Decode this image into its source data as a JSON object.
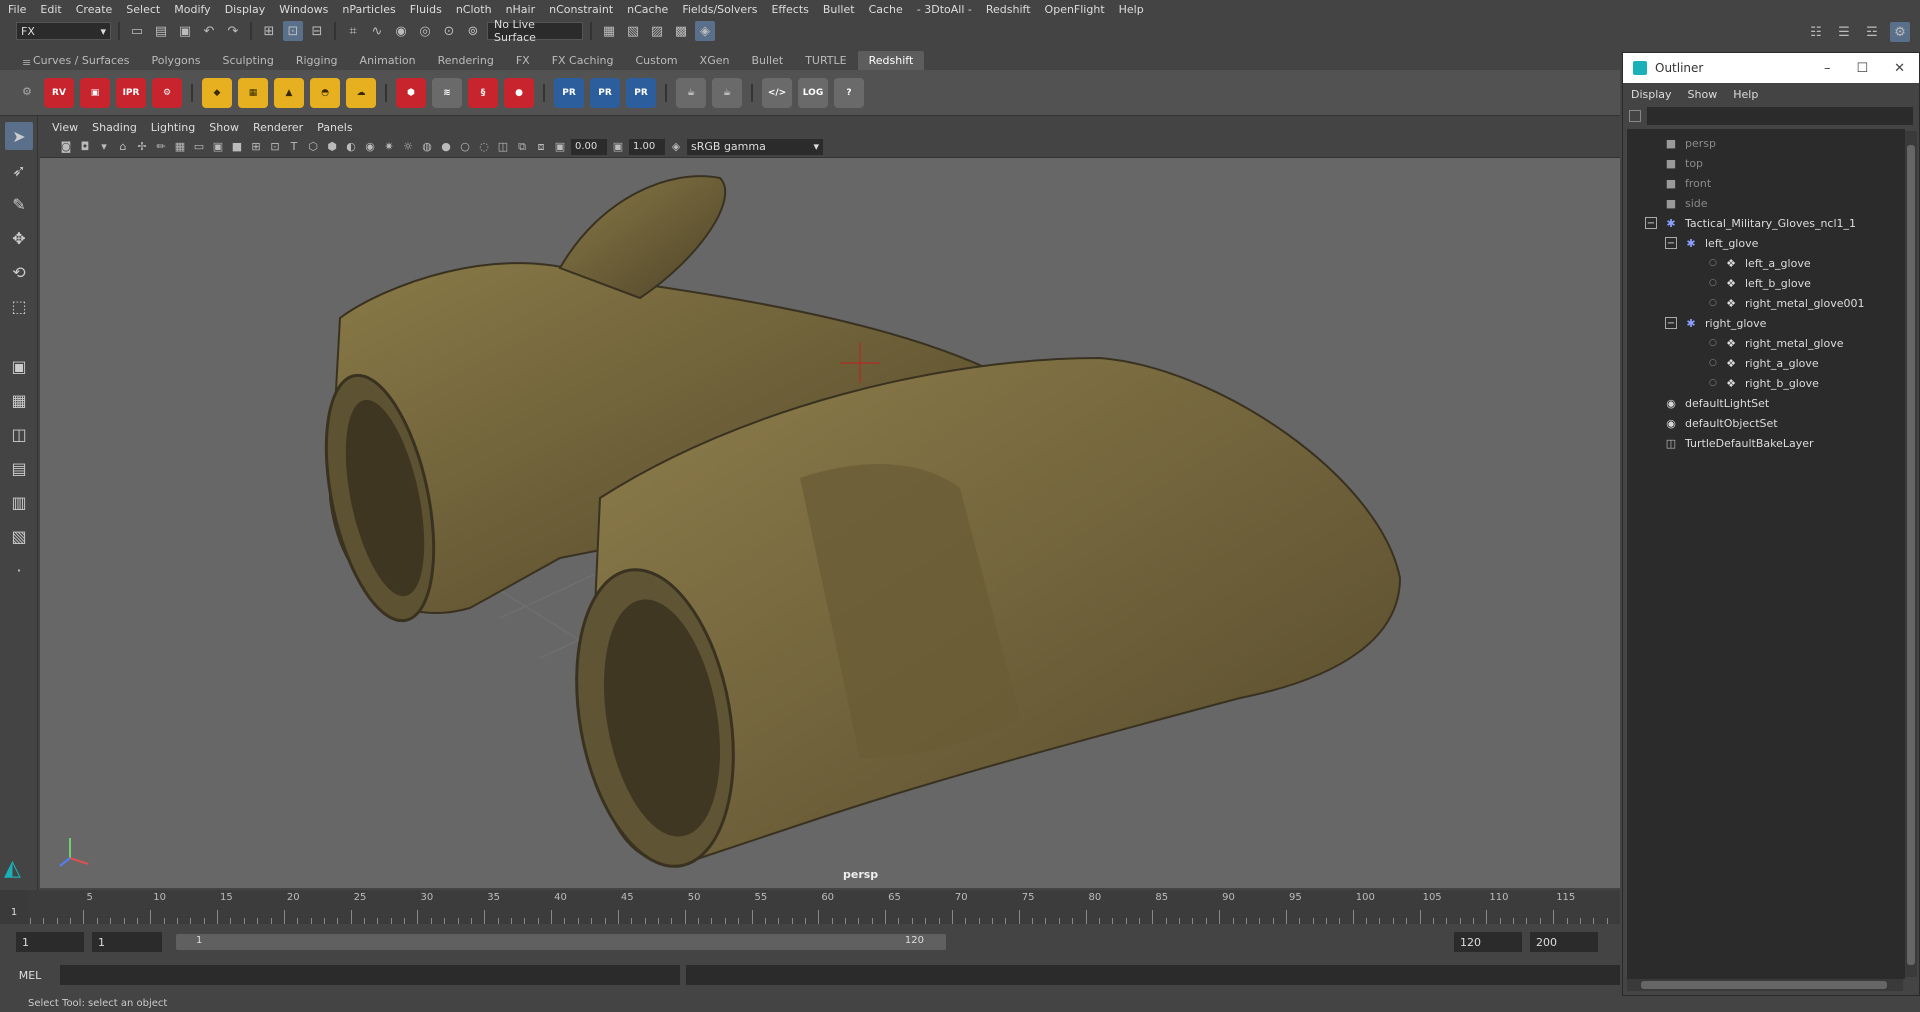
{
  "menubar": [
    "File",
    "Edit",
    "Create",
    "Select",
    "Modify",
    "Display",
    "Windows",
    "nParticles",
    "Fluids",
    "nCloth",
    "nHair",
    "nConstraint",
    "nCache",
    "Fields/Solvers",
    "Effects",
    "Bullet",
    "Cache",
    "- 3DtoAll -",
    "Redshift",
    "OpenFlight",
    "Help"
  ],
  "status": {
    "mode": "FX",
    "live_surface": "No Live Surface"
  },
  "shelf_tabs": [
    "Curves / Surfaces",
    "Polygons",
    "Sculpting",
    "Rigging",
    "Animation",
    "Rendering",
    "FX",
    "FX Caching",
    "Custom",
    "XGen",
    "Bullet",
    "TURTLE",
    "Redshift"
  ],
  "shelf_icons": {
    "rv": "RV",
    "ipr": "IPR",
    "pr": "PR",
    "log": "LOG"
  },
  "viewport": {
    "menu": [
      "View",
      "Shading",
      "Lighting",
      "Show",
      "Renderer",
      "Panels"
    ],
    "exposure": "0.00",
    "gamma": "1.00",
    "colorspace": "sRGB gamma",
    "camera_label": "persp"
  },
  "timeline": {
    "ticks": [
      "5",
      "10",
      "15",
      "20",
      "25",
      "30",
      "35",
      "40",
      "45",
      "50",
      "55",
      "60",
      "65",
      "70",
      "75",
      "80",
      "85",
      "90",
      "95",
      "100",
      "105",
      "110",
      "115"
    ],
    "current": "1"
  },
  "range": {
    "start": "1",
    "playback_start": "1",
    "slider_start": "1",
    "slider_end": "120",
    "playback_end": "120",
    "end": "200"
  },
  "cmd": {
    "label": "MEL"
  },
  "help_line": "Select Tool: select an object",
  "outliner": {
    "title": "Outliner",
    "menu": [
      "Display",
      "Show",
      "Help"
    ],
    "items": [
      {
        "label": "persp",
        "level": 0,
        "dim": true,
        "icon": "camera-icon"
      },
      {
        "label": "top",
        "level": 0,
        "dim": true,
        "icon": "camera-icon"
      },
      {
        "label": "front",
        "level": 0,
        "dim": true,
        "icon": "camera-icon"
      },
      {
        "label": "side",
        "level": 0,
        "dim": true,
        "icon": "camera-icon"
      },
      {
        "label": "Tactical_Military_Gloves_ncl1_1",
        "level": 0,
        "expand": "−",
        "icon": "group-icon"
      },
      {
        "label": "left_glove",
        "level": 1,
        "expand": "−",
        "icon": "group-icon"
      },
      {
        "label": "left_a_glove",
        "level": 2,
        "icon": "mesh-icon"
      },
      {
        "label": "left_b_glove",
        "level": 2,
        "icon": "mesh-icon"
      },
      {
        "label": "right_metal_glove001",
        "level": 2,
        "icon": "mesh-icon"
      },
      {
        "label": "right_glove",
        "level": 1,
        "expand": "−",
        "icon": "group-icon"
      },
      {
        "label": "right_metal_glove",
        "level": 2,
        "icon": "mesh-icon"
      },
      {
        "label": "right_a_glove",
        "level": 2,
        "icon": "mesh-icon"
      },
      {
        "label": "right_b_glove",
        "level": 2,
        "icon": "mesh-icon"
      },
      {
        "label": "defaultLightSet",
        "level": 0,
        "icon": "set-icon"
      },
      {
        "label": "defaultObjectSet",
        "level": 0,
        "icon": "set-icon"
      },
      {
        "label": "TurtleDefaultBakeLayer",
        "level": 0,
        "icon": "layer-icon"
      }
    ]
  }
}
